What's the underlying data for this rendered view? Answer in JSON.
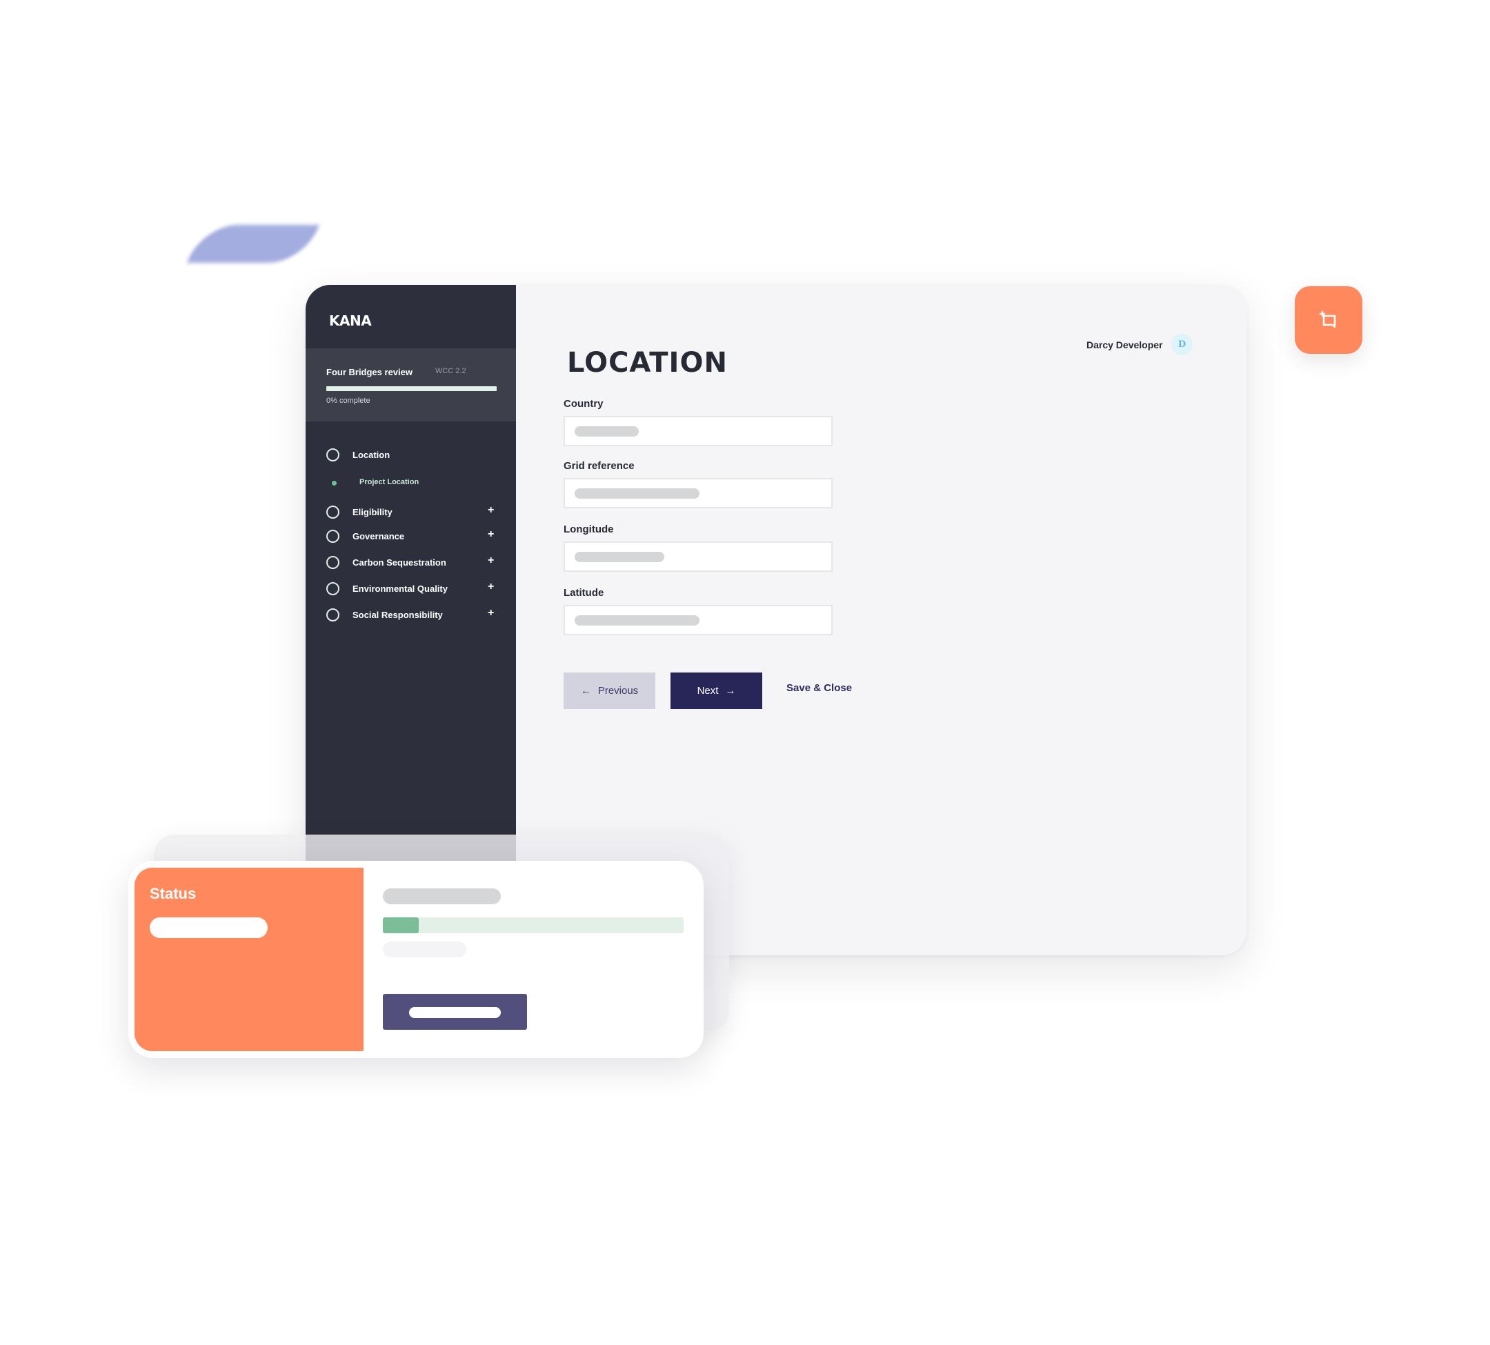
{
  "app": {
    "logo": "KANA",
    "icons": {
      "add_comment": "add-comment-icon",
      "arrow_left": "←",
      "arrow_right": "→",
      "plus": "+"
    }
  },
  "project": {
    "name": "Four Bridges review",
    "code": "WCC 2.2",
    "progress_percent": 0,
    "progress_text": "0% complete"
  },
  "nav": {
    "items": [
      {
        "label": "Location",
        "expandable": false
      },
      {
        "label": "Eligibility",
        "expandable": true
      },
      {
        "label": "Governance",
        "expandable": true
      },
      {
        "label": "Carbon Sequestration",
        "expandable": true
      },
      {
        "label": "Environmental Quality",
        "expandable": true
      },
      {
        "label": "Social Responsibility",
        "expandable": true
      }
    ],
    "sub_items": [
      {
        "label": "Project Location",
        "active": true
      }
    ]
  },
  "user": {
    "name": "Darcy Developer",
    "initial": "D"
  },
  "page": {
    "title": "LOCATION",
    "fields": [
      {
        "label": "Country",
        "value": ""
      },
      {
        "label": "Grid reference",
        "value": ""
      },
      {
        "label": "Longitude",
        "value": ""
      },
      {
        "label": "Latitude",
        "value": ""
      }
    ],
    "buttons": {
      "previous": "Previous",
      "next": "Next",
      "save_close": "Save & Close"
    }
  },
  "status_card": {
    "title": "Status",
    "progress_fraction": 0.12
  },
  "colors": {
    "accent_orange": "#ff885d",
    "sidebar_dark": "#2d303c",
    "primary_navy": "#282659",
    "progress_green": "#7bbd97",
    "progress_track": "#e3f0e8",
    "secondary_purple": "#534f7c"
  }
}
